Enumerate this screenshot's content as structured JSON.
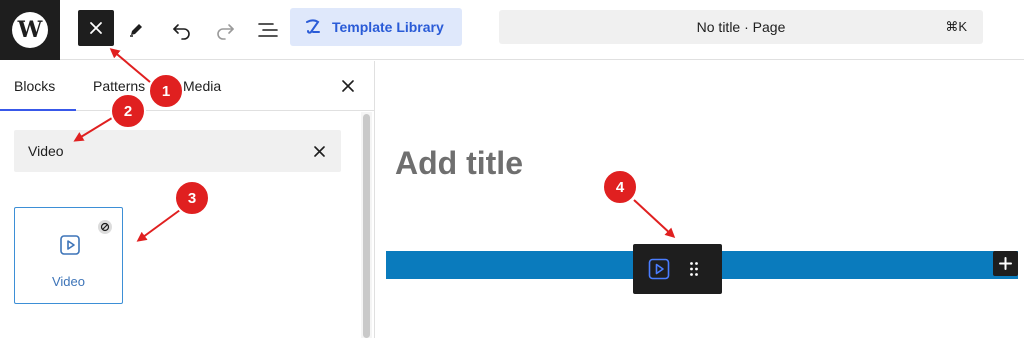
{
  "topbar": {
    "logo": "W",
    "close_icon": "close-icon",
    "template_library_label": "Template Library",
    "command_title": "No title · Page",
    "command_shortcut": "⌘K"
  },
  "sidebar": {
    "tabs": [
      {
        "label": "Blocks",
        "active": true
      },
      {
        "label": "Patterns",
        "active": false
      },
      {
        "label": "Media",
        "active": false
      }
    ],
    "search_value": "Video",
    "results": [
      {
        "label": "Video",
        "icon": "video-icon"
      }
    ]
  },
  "canvas": {
    "title_placeholder": "Add title"
  },
  "annotations": [
    "1",
    "2",
    "3",
    "4"
  ],
  "colors": {
    "accent": "#3858e9",
    "template_library_bg": "#dfe8fb",
    "template_library_text": "#2a5bd7",
    "video_bar": "#0a7bbd",
    "callout": "#e02020",
    "dark": "#1e1e1e"
  }
}
